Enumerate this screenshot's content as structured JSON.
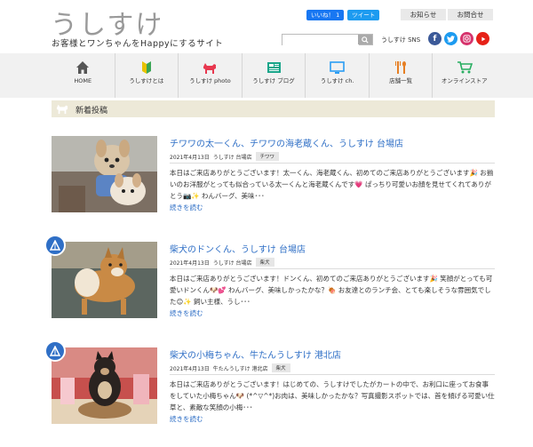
{
  "site": {
    "logo": "うしすけ",
    "tagline": "お客様とワンちゃんをHappyにするサイト"
  },
  "topbar": {
    "like_label": "いいね！ 1",
    "tweet_label": "ツイート",
    "info_label": "お知らせ",
    "contact_label": "お問合せ"
  },
  "search": {
    "placeholder": ""
  },
  "sns": {
    "label": "うしすけ SNS",
    "icons": [
      "facebook-icon",
      "twitter-icon",
      "instagram-icon",
      "youtube-icon"
    ],
    "colors": [
      "#3b5998",
      "#1d9bf0",
      "#d6336c",
      "#e62117"
    ]
  },
  "nav": {
    "items": [
      {
        "label": "HOME",
        "icon": "house-icon",
        "color": "#555555"
      },
      {
        "label": "うしすけとは",
        "icon": "leaf-mark-icon",
        "color": "#e8c200"
      },
      {
        "label": "うしすけ photo",
        "icon": "dog-icon",
        "color": "#e8384f"
      },
      {
        "label": "うしすけ ブログ",
        "icon": "book-icon",
        "color": "#17a589"
      },
      {
        "label": "うしすけ ch.",
        "icon": "monitor-icon",
        "color": "#2a9df4"
      },
      {
        "label": "店舗一覧",
        "icon": "cutlery-icon",
        "color": "#e67e22"
      },
      {
        "label": "オンラインストア",
        "icon": "cart-icon",
        "color": "#27ae60"
      }
    ]
  },
  "section": {
    "title": "新着投稿"
  },
  "posts": [
    {
      "title": "チワワの太一くん、チワワの海老蔵くん、うしすけ 台場店",
      "date": "2021年4月13日",
      "store": "うしすけ 台場店",
      "tag": "チワワ",
      "excerpt": "本日はご来店ありがとうございます！太一くん、海老蔵くん、初めてのご来店ありがとうございます🎉 お揃いのお洋服がとっても似合っている太一くんと海老蔵くんです💗 ぱっちり可愛いお顔を見せてくれてありがとう📷✨ わんバーグ、美味･･･",
      "more": "続きを読む",
      "badge": false
    },
    {
      "title": "柴犬のドンくん、うしすけ 台場店",
      "date": "2021年4月13日",
      "store": "うしすけ 台場店",
      "tag": "柴犬",
      "excerpt": "本日はご来店ありがとうございます！ドンくん、初めてのご来店ありがとうございます🎉 笑顔がとっても可愛いドンくん🐶💕 わんバーグ、美味しかったかな？🍖 お友達とのランチ会、とても楽しそうな雰囲気でした😊✨ 飼い主様、うし･･･",
      "more": "続きを読む",
      "badge": true
    },
    {
      "title": "柴犬の小梅ちゃん、牛たんうしすけ 港北店",
      "date": "2021年4月13日",
      "store": "牛たんうしすけ 港北店",
      "tag": "柴犬",
      "excerpt": "本日はご来店ありがとうございます！はじめての、うしすけでしたがカートの中で、お利口に座ってお食事をしていた小梅ちゃん🐶 (*^▽^*)お肉は、美味しかったかな？写真撮影スポットでは、首を傾げる可愛い仕草と、素敵な笑顔の小梅･･･",
      "more": "続きを読む",
      "badge": true
    }
  ]
}
